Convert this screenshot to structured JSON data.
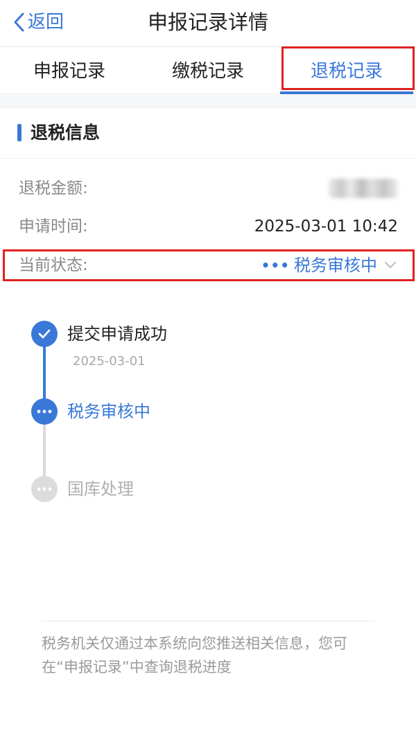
{
  "nav": {
    "back_label": "返回",
    "title": "申报记录详情"
  },
  "tabs": [
    {
      "label": "申报记录",
      "active": false
    },
    {
      "label": "缴税记录",
      "active": false
    },
    {
      "label": "退税记录",
      "active": true
    }
  ],
  "section": {
    "title": "退税信息"
  },
  "fields": {
    "amount_label": "退税金额:",
    "apply_time_label": "申请时间:",
    "apply_time_value": "2025-03-01 10:42",
    "status_label": "当前状态:",
    "status_value": "税务审核中"
  },
  "timeline": [
    {
      "label": "提交申请成功",
      "date": "2025-03-01",
      "state": "done"
    },
    {
      "label": "税务审核中",
      "date": "",
      "state": "current"
    },
    {
      "label": "国库处理",
      "date": "",
      "state": "pending"
    }
  ],
  "notice": "税务机关仅通过本系统向您推送相关信息，您可在“申报记录”中查询退税进度",
  "colors": {
    "accent": "#3a78d8",
    "highlight": "#e02020",
    "pending": "#d9d9d9"
  }
}
